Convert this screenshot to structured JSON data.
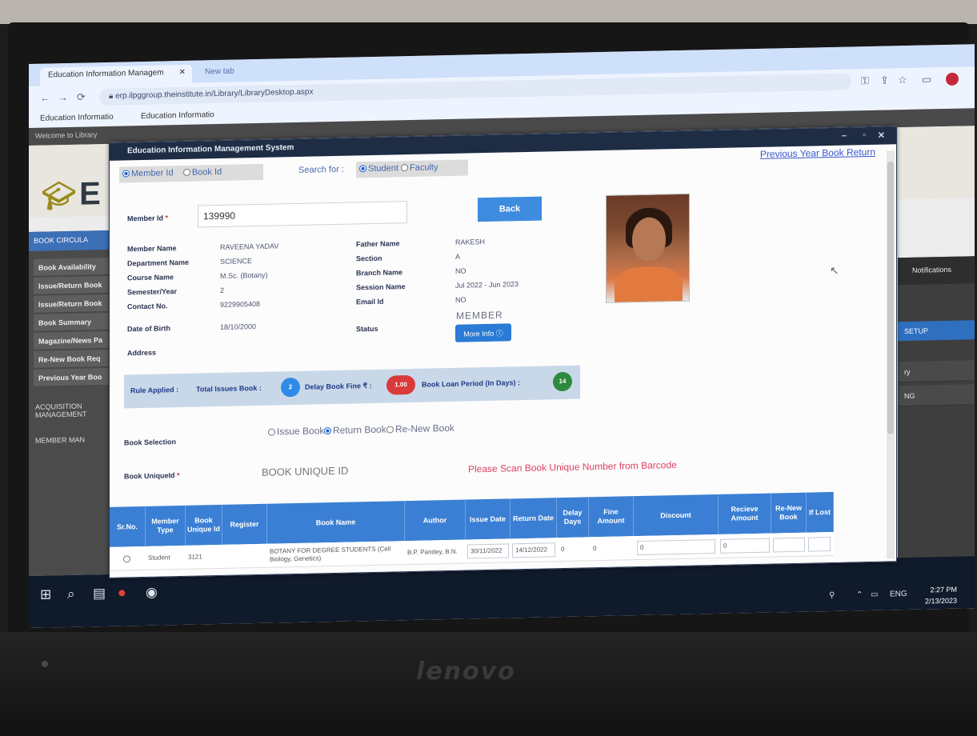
{
  "laptop_brand": "lenovo",
  "browser": {
    "tabs": [
      {
        "label": "Education Information Managem"
      },
      {
        "label": "New tab"
      }
    ],
    "url": "erp.ilpggroup.theinstitute.in/Library/LibraryDesktop.aspx",
    "bookmarks": [
      "Education Informatio",
      "Education Informatio"
    ]
  },
  "background_page": {
    "top_strip": "Welcome to Library",
    "logo_letter": "E",
    "sidebar_header": "BOOK CIRCULA",
    "sidebar_items": [
      "Book Availability",
      "Issue/Return Book",
      "Issue/Return Book",
      "Book Summary",
      "Magazine/News Pa",
      "Re-New Book Req",
      "Previous Year Boo"
    ],
    "sidebar_sections": [
      "ACQUISITION MANAGEMENT",
      "MEMBER MAN"
    ],
    "right_notifications": "Notifications",
    "right_setup": "SETUP",
    "right_items": [
      "ry",
      "NG"
    ]
  },
  "app": {
    "title": "Education Information Management System",
    "search_by": {
      "options": [
        "Member Id",
        "Book Id"
      ],
      "selected": "Member Id"
    },
    "search_for": {
      "label": "Search for :",
      "options": [
        "Student",
        "Faculty"
      ],
      "selected": "Student"
    },
    "previous_year_link": "Previous Year Book Return",
    "member_id_label": "Member Id",
    "member_id_required": "*",
    "member_id_value": "139990",
    "back_label": "Back",
    "details": {
      "member_name_label": "Member Name",
      "member_name": "RAVEENA YADAV",
      "department_label": "Department Name",
      "department": "SCIENCE",
      "course_label": "Course Name",
      "course": "M.Sc. (Botany)",
      "semester_label": "Semester/Year",
      "semester": "2",
      "contact_label": "Contact No.",
      "contact": "9229905408",
      "dob_label": "Date of Birth",
      "dob": "18/10/2000",
      "address_label": "Address",
      "address": "",
      "father_label": "Father Name",
      "father": "RAKESH",
      "section_label": "Section",
      "section": "A",
      "branch_label": "Branch Name",
      "branch": "NO",
      "session_label": "Session Name",
      "session": "Jul 2022 - Jun 2023",
      "email_label": "Email Id",
      "email": "NO",
      "status_label": "Status",
      "status": "MEMBER",
      "more_info_label": "More Info"
    },
    "rules": {
      "applied_label": "Rule Applied :",
      "total_issues_label": "Total Issues Book :",
      "total_issues": "2",
      "delay_fine_label": "Delay Book Fine ₹ :",
      "delay_fine": "1.00",
      "loan_period_label": "Book Loan Period (In Days) :",
      "loan_period": "14"
    },
    "book_selection": {
      "label": "Book Selection",
      "options": [
        "Issue Book",
        "Return Book",
        "Re-New Book"
      ],
      "selected": "Return Book"
    },
    "book_unique_id_label": "Book UniqueId",
    "book_unique_id_required": "*",
    "book_unique_id_placeholder": "BOOK UNIQUE ID",
    "scan_message": "Please Scan Book Unique Number from Barcode",
    "table": {
      "columns": [
        "Sr.No.",
        "Member Type",
        "Book Unique Id",
        "Register",
        "Book Name",
        "Author",
        "Issue Date",
        "Return Date",
        "Delay Days",
        "Fine Amount",
        "Discount",
        "Recieve Amount",
        "Re-New Book",
        "If Lost"
      ],
      "rows": [
        {
          "sr": "",
          "member_type": "Student",
          "unique_id": "3121",
          "register": "",
          "book_name": "BOTANY FOR DEGREE STUDENTS (Cell Biology, Genetics)",
          "author": "B.P. Pandey, B.N.",
          "issue_date": "30/11/2022",
          "return_date": "14/12/2022",
          "delay_days": "0",
          "fine_amount": "0",
          "discount": "0",
          "receive_amount": "0",
          "renew": "",
          "lost": ""
        }
      ]
    }
  },
  "taskbar": {
    "language": "ENG",
    "time": "2:27 PM",
    "date": "2/13/2023"
  }
}
